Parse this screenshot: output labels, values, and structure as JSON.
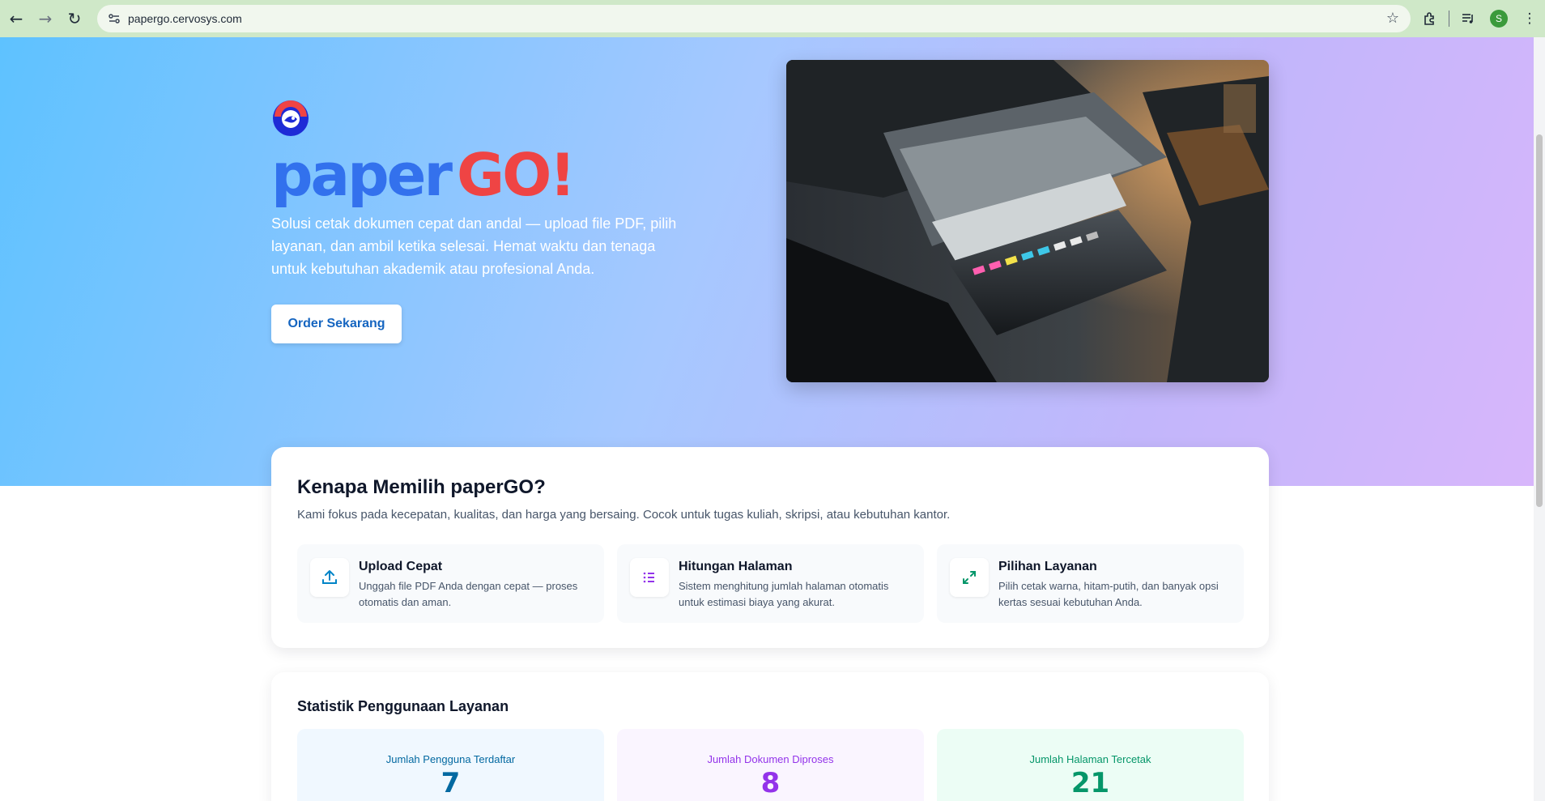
{
  "browser": {
    "url": "papergo.cervosys.com",
    "profile_initial": "S"
  },
  "hero": {
    "brand_part1": "paper",
    "brand_part2": "GO!",
    "tagline": "Solusi cetak dokumen cepat dan andal — upload file PDF, pilih layanan, dan ambil ketika selesai. Hemat waktu dan tenaga untuk kebutuhan akademik atau profesional Anda.",
    "cta_label": "Order Sekarang"
  },
  "why": {
    "title": "Kenapa Memilih paperGO?",
    "subtitle": "Kami fokus pada kecepatan, kualitas, dan harga yang bersaing. Cocok untuk tugas kuliah, skripsi, atau kebutuhan kantor.",
    "features": [
      {
        "icon": "upload-icon",
        "title": "Upload Cepat",
        "desc": "Unggah file PDF Anda dengan cepat — proses otomatis dan aman."
      },
      {
        "icon": "list-icon",
        "title": "Hitungan Halaman",
        "desc": "Sistem menghitung jumlah halaman otomatis untuk estimasi biaya yang akurat."
      },
      {
        "icon": "expand-icon",
        "title": "Pilihan Layanan",
        "desc": "Pilih cetak warna, hitam-putih, dan banyak opsi kertas sesuai kebutuhan Anda."
      }
    ]
  },
  "stats": {
    "title": "Statistik Penggunaan Layanan",
    "items": [
      {
        "label": "Jumlah Pengguna Terdaftar",
        "value": "7",
        "color": "#0369a1",
        "bg": "#f0f8ff"
      },
      {
        "label": "Jumlah Dokumen Diproses",
        "value": "8",
        "color": "#9333ea",
        "bg": "#faf5ff"
      },
      {
        "label": "Jumlah Halaman Tercetak",
        "value": "21",
        "color": "#059669",
        "bg": "#ecfdf5"
      }
    ]
  },
  "colors": {
    "brand_blue": "#2563eb",
    "brand_red": "#ef4444",
    "cta_text": "#1565c0"
  }
}
